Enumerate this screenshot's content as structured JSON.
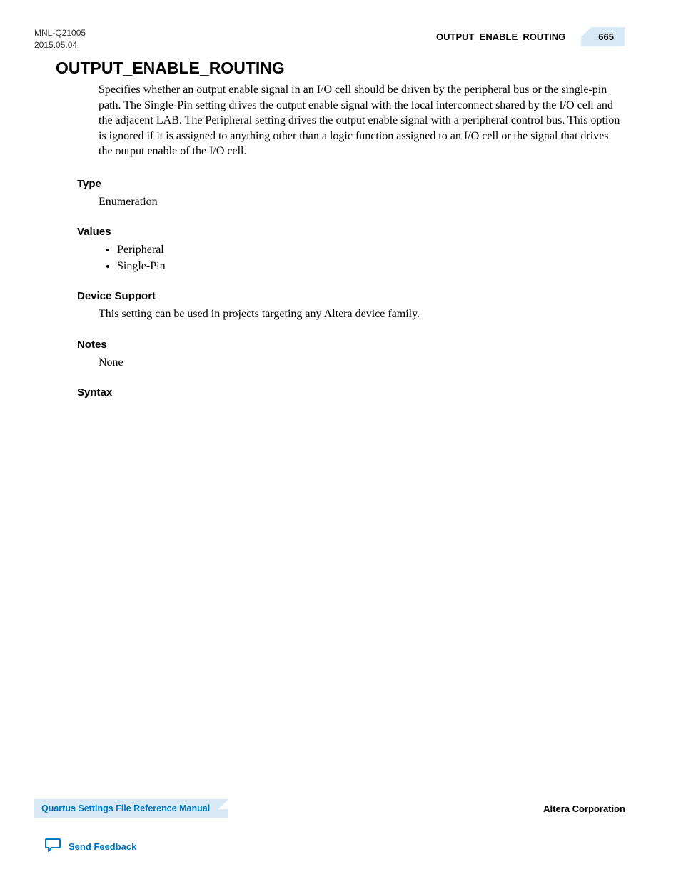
{
  "header": {
    "doc_id": "MNL-Q21005",
    "date": "2015.05.04",
    "running_title": "OUTPUT_ENABLE_ROUTING",
    "page_number": "665"
  },
  "main": {
    "title": "OUTPUT_ENABLE_ROUTING",
    "description": "Specifies whether an output enable signal in an I/O cell should be driven by the peripheral bus or the single-pin path. The Single-Pin setting drives the output enable signal with the local interconnect shared by the I/O cell and the adjacent LAB. The Peripheral setting drives the output enable signal with a peripheral control bus. This option is ignored if it is assigned to anything other than a logic function assigned to an I/O cell or the signal that drives the output enable of the I/O cell.",
    "sections": {
      "type": {
        "heading": "Type",
        "value": "Enumeration"
      },
      "values": {
        "heading": "Values",
        "items": [
          "Peripheral",
          "Single-Pin"
        ]
      },
      "device_support": {
        "heading": "Device Support",
        "value": "This setting can be used in projects targeting any Altera device family."
      },
      "notes": {
        "heading": "Notes",
        "value": "None"
      },
      "syntax": {
        "heading": "Syntax"
      }
    }
  },
  "footer": {
    "manual_title": "Quartus Settings File Reference Manual",
    "company": "Altera Corporation",
    "feedback": "Send Feedback"
  }
}
